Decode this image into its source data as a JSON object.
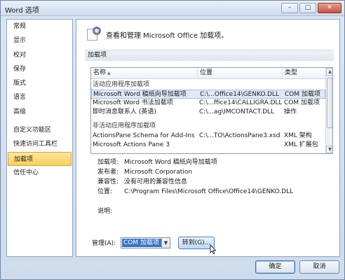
{
  "window": {
    "title": "Word 选项",
    "minimize": "–",
    "maximize": "□",
    "close": "✕"
  },
  "sidebar": {
    "items": [
      {
        "label": "常规"
      },
      {
        "label": "显示"
      },
      {
        "label": "校对"
      },
      {
        "label": "保存"
      },
      {
        "label": "版式"
      },
      {
        "label": "语言"
      },
      {
        "label": "高级"
      },
      {
        "label": "自定义功能区"
      },
      {
        "label": "快速访问工具栏"
      },
      {
        "label": "加载项"
      },
      {
        "label": "信任中心"
      }
    ],
    "selected": "加载项"
  },
  "main": {
    "header": "查看和管理 Microsoft Office 加载项。",
    "section": "加载项",
    "table": {
      "columns": [
        "名称",
        "位置",
        "类型"
      ],
      "sort_indicator": "▲",
      "rows": [
        {
          "group": "活动应用程序加载项"
        },
        {
          "name": "Microsoft Word 稿纸向导加载项",
          "location": "C:\\...Office14\\GENKO.DLL",
          "type": "COM 加载项"
        },
        {
          "name": "Microsoft Word 书法加载项",
          "location": "C:\\...ffice14\\CALLIGRA.DLL",
          "type": "COM 加载项"
        },
        {
          "name": "即时消息联系人 (英语)",
          "location": "C:\\...ag\\IMCONTACT.DLL",
          "type": "操作"
        },
        {
          "group": "非活动应用程序加载项"
        },
        {
          "name": "ActionsPane Schema for Add-Ins",
          "location": "C:\\...TO\\ActionsPane3.xsd",
          "type": "XML 架构"
        },
        {
          "name": "Microsoft Actions Pane 3",
          "location": "",
          "type": "XML 扩展包"
        }
      ]
    },
    "details": {
      "addin_label": "加载项:",
      "addin_value": "Microsoft Word 稿纸向导加载项",
      "publisher_label": "发布者:",
      "publisher_value": "Microsoft Corporation",
      "compat_label": "兼容性:",
      "compat_value": "没有可用的兼容性信息",
      "location_label": "位置:",
      "location_value": "C:\\Program Files\\Microsoft Office\\Office14\\GENKO.DLL",
      "desc_label": "说明:"
    },
    "manage": {
      "label": "管理(A):",
      "value": "COM 加载项",
      "dropdown_arrow": "▼",
      "go_button": "转到(G)..."
    }
  },
  "footer": {
    "ok": "确定",
    "cancel": "取消"
  },
  "scrollbar": {
    "up": "▲",
    "down": "▼"
  }
}
